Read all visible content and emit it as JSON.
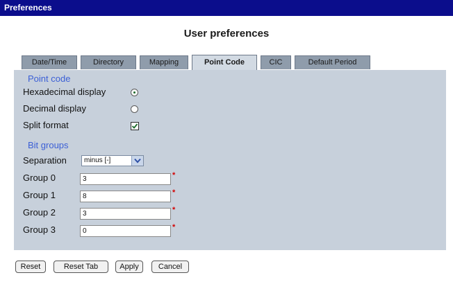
{
  "window": {
    "title": "Preferences"
  },
  "page": {
    "heading": "User preferences"
  },
  "tabs": [
    {
      "label": "Date/Time",
      "active": false
    },
    {
      "label": "Directory",
      "active": false
    },
    {
      "label": "Mapping",
      "active": false
    },
    {
      "label": "Point Code",
      "active": true
    },
    {
      "label": "CIC",
      "active": false
    },
    {
      "label": "Default Period",
      "active": false
    }
  ],
  "point_code": {
    "section_title": "Point code",
    "hex_label": "Hexadecimal display",
    "hex_selected": true,
    "dec_label": "Decimal display",
    "dec_selected": false,
    "split_label": "Split format",
    "split_checked": true
  },
  "bit_groups": {
    "section_title": "Bit groups",
    "separation_label": "Separation",
    "separation_value": "minus [-]",
    "groups": [
      {
        "label": "Group 0",
        "value": "3"
      },
      {
        "label": "Group 1",
        "value": "8"
      },
      {
        "label": "Group 2",
        "value": "3"
      },
      {
        "label": "Group 3",
        "value": "0"
      }
    ],
    "required_mark": "*"
  },
  "buttons": {
    "reset": "Reset",
    "reset_tab": "Reset Tab",
    "apply": "Apply",
    "cancel": "Cancel"
  },
  "colors": {
    "titlebar": "#0b0d8c",
    "panel": "#c7d0db",
    "section_title": "#3b5fd6",
    "required": "#d40000"
  },
  "icons": {
    "dropdown": "chevron-down-icon",
    "checkbox": "checkmark-icon",
    "radio": "radio-dot-icon"
  }
}
